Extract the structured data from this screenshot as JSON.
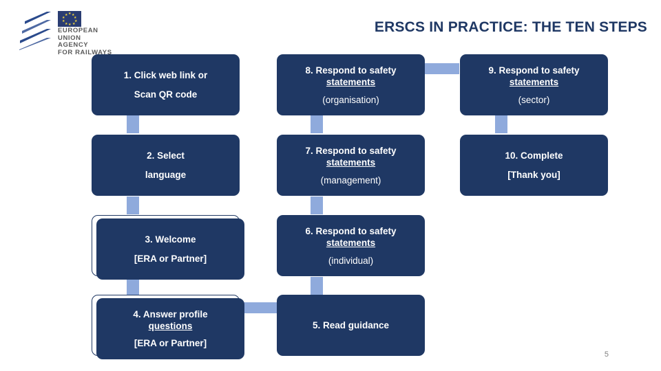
{
  "logo": {
    "name": "eu-agency-for-railways-logo",
    "line1": "EUROPEAN",
    "line2": "UNION",
    "line3": "AGENCY",
    "line4": "FOR RAILWAYS",
    "flag_alt": "eu-flag-icon"
  },
  "title": "ERSCS IN PRACTICE: THE TEN STEPS",
  "page_number": "5",
  "colors": {
    "box_fill": "#1f3864",
    "connector": "#8faadc",
    "title_text": "#1f3864",
    "logo_text": "#5a5a5a",
    "page_number_text": "#808080"
  },
  "boxes": [
    {
      "id": "step-1",
      "line1": "1. Click web link or",
      "line2": "Scan QR code",
      "line3": "",
      "outlined": false
    },
    {
      "id": "step-2",
      "line1": "2. Select",
      "line2": "language",
      "line3": "",
      "outlined": false
    },
    {
      "id": "step-3",
      "line1": "3. Welcome",
      "line2": "[ERA or Partner]",
      "line3": "",
      "outlined": true
    },
    {
      "id": "step-4",
      "line1": "4. Answer profile",
      "line1b": "questions",
      "line2": "[ERA or Partner]",
      "line3": "",
      "outlined": true
    },
    {
      "id": "step-5",
      "line1": "5. Read guidance",
      "line2": "",
      "line3": "",
      "outlined": false
    },
    {
      "id": "step-6",
      "line1": "6. Respond to safety",
      "line1b": "statements",
      "line2": "(individual)",
      "line3": "",
      "outlined": false
    },
    {
      "id": "step-7",
      "line1": "7. Respond to safety",
      "line1b": "statements",
      "line2": "(management)",
      "line3": "",
      "outlined": false
    },
    {
      "id": "step-8",
      "line1": "8. Respond to safety",
      "line1b": "statements",
      "line2": "(organisation)",
      "line3": "",
      "outlined": false
    },
    {
      "id": "step-9",
      "line1": "9. Respond to safety",
      "line1b": "statements",
      "line2": "(sector)",
      "line3": "",
      "outlined": false
    },
    {
      "id": "step-10",
      "line1": "10. Complete",
      "line2": "[Thank you]",
      "line3": "",
      "outlined": false
    }
  ]
}
